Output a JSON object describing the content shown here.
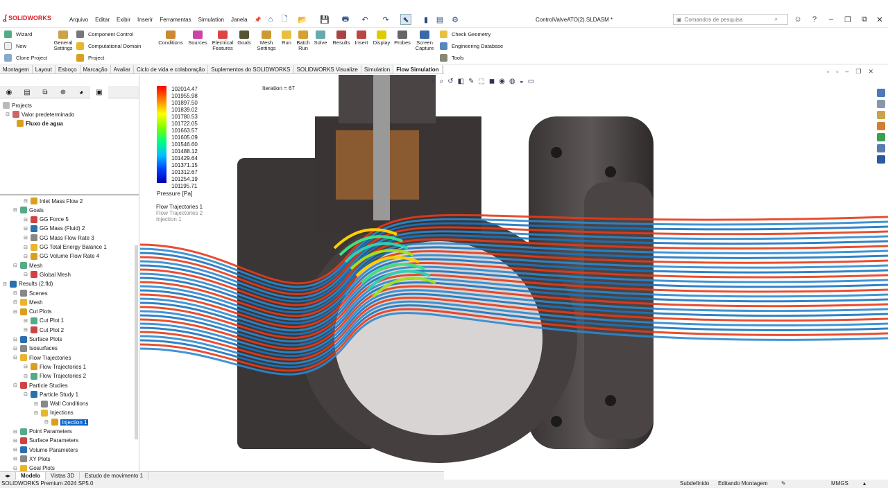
{
  "app": {
    "logo_text": "SOLIDWORKS",
    "doc_title": "ControlValveATO(2).SLDASM *",
    "brand_color": "#d9232e"
  },
  "menu": [
    "Arquivo",
    "Editar",
    "Exibir",
    "Inserir",
    "Ferramentas",
    "Simulation",
    "Janela"
  ],
  "search": {
    "placeholder": "Comandos de pesquisa"
  },
  "ribbon": {
    "wizard": "Wizard",
    "new": "New",
    "clone_project": "Clone Project",
    "general_settings_1": "General",
    "general_settings_2": "Settings",
    "component_control": "Component Control",
    "computational_domain": "Computational Domain",
    "project": "Project",
    "conditions": "Conditions",
    "sources": "Sources",
    "electrical_1": "Electrical",
    "electrical_2": "Features",
    "goals": "Goals",
    "mesh_1": "Mesh",
    "mesh_2": "Settings",
    "run": "Run",
    "batch_1": "Batch",
    "batch_2": "Run",
    "solve": "Solve",
    "results": "Results",
    "insert": "Insert",
    "display": "Display",
    "probes": "Probes",
    "screen_1": "Screen",
    "screen_2": "Capture",
    "check_geometry": "Check Geometry",
    "engineering_db": "Engineering Database",
    "tools": "Tools"
  },
  "tabs": [
    "Montagem",
    "Layout",
    "Esboço",
    "Marcação",
    "Avaliar",
    "Ciclo de vida e colaboração",
    "Suplementos do SOLIDWORKS",
    "SOLIDWORKS Visualize",
    "Simulation",
    "Flow Simulation"
  ],
  "tree_top": {
    "projects": "Projects",
    "default": "Valor predeterminado",
    "fluxo": "Fluxo de agua"
  },
  "tree": [
    {
      "label": "Inlet Mass Flow 2",
      "level": 3
    },
    {
      "label": "Goals",
      "level": 2
    },
    {
      "label": "GG Force 5",
      "level": 3
    },
    {
      "label": "GG Mass (Fluid) 2",
      "level": 3
    },
    {
      "label": "GG Mass Flow Rate 3",
      "level": 3
    },
    {
      "label": "GG Total Energy Balance 1",
      "level": 3
    },
    {
      "label": "GG Volume Flow Rate 4",
      "level": 3
    },
    {
      "label": "Mesh",
      "level": 2
    },
    {
      "label": "Global Mesh",
      "level": 3
    },
    {
      "label": "Results (2.fld)",
      "level": 1
    },
    {
      "label": "Scenes",
      "level": 2
    },
    {
      "label": "Mesh",
      "level": 2
    },
    {
      "label": "Cut Plots",
      "level": 2
    },
    {
      "label": "Cut Plot 1",
      "level": 3
    },
    {
      "label": "Cut Plot 2",
      "level": 3
    },
    {
      "label": "Surface Plots",
      "level": 2
    },
    {
      "label": "Isosurfaces",
      "level": 2
    },
    {
      "label": "Flow Trajectories",
      "level": 2
    },
    {
      "label": "Flow Trajectories 1",
      "level": 3
    },
    {
      "label": "Flow Trajectories 2",
      "level": 3
    },
    {
      "label": "Particle Studies",
      "level": 2
    },
    {
      "label": "Particle Study 1",
      "level": 3
    },
    {
      "label": "Wall Conditions",
      "level": 4
    },
    {
      "label": "Injections",
      "level": 4
    },
    {
      "label": "Injection 1",
      "level": 5
    },
    {
      "label": "Point Parameters",
      "level": 2
    },
    {
      "label": "Surface Parameters",
      "level": 2
    },
    {
      "label": "Volume Parameters",
      "level": 2
    },
    {
      "label": "XY Plots",
      "level": 2
    },
    {
      "label": "Goal Plots",
      "level": 2
    }
  ],
  "legend": {
    "values": [
      "102014.47",
      "101955.98",
      "101897.50",
      "101839.02",
      "101780.53",
      "101722.05",
      "101663.57",
      "101605.09",
      "101546.60",
      "101488.12",
      "101429.64",
      "101371.15",
      "101312.67",
      "101254.19",
      "101195.71"
    ],
    "title": "Pressure [Pa]",
    "layers": [
      "Flow Trajectories 1",
      "Flow Trajectories 2",
      "Injection 1"
    ],
    "iteration": "Iteration = 67"
  },
  "bottom_tabs": [
    "Modelo",
    "Vistas 3D",
    "Estudo de movimento 1"
  ],
  "status": {
    "version": "SOLIDWORKS Premium 2024 SP5.0",
    "state": "Subdefinido",
    "mode": "Editando Montagem",
    "units": "MMGS"
  }
}
